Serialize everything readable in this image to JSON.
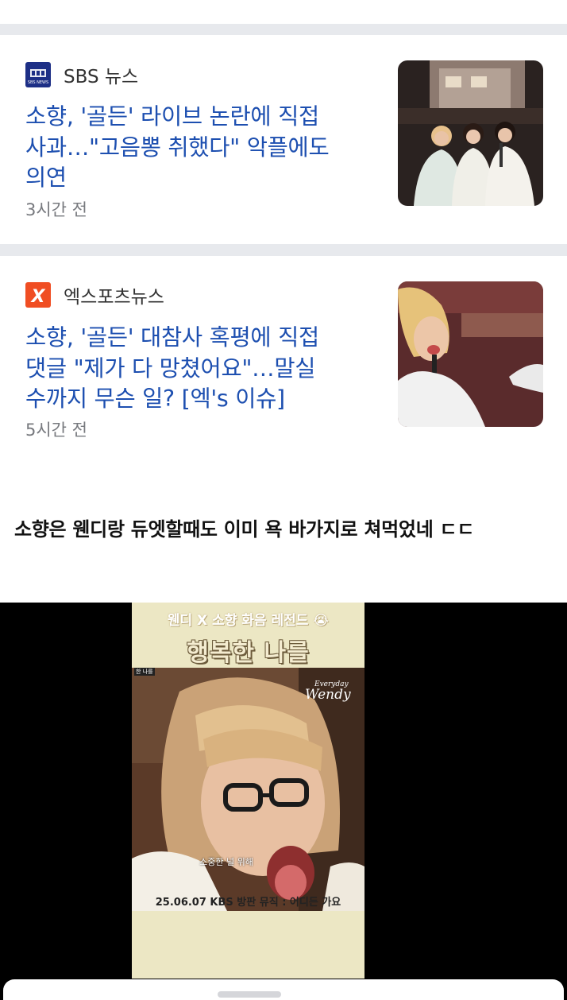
{
  "articles": [
    {
      "source": "SBS 뉴스",
      "logo": "SBS NEWS",
      "headline_lines": [
        "소향, '골든' 라이브 논란에 직접",
        "사과…\"고음뽕 취했다\" 악플에도",
        "의연"
      ],
      "time": "3시간 전",
      "accent": "#1d2f86"
    },
    {
      "source": "엑스포츠뉴스",
      "logo": "X",
      "headline_lines": [
        "소향, '골든' 대참사 혹평에 직접",
        "댓글 \"제가 다 망쳤어요\"…말실",
        "수까지 무슨 일? [엑's 이슈]"
      ],
      "time": "5시간 전",
      "accent": "#f04e23"
    }
  ],
  "comment": "소향은 웬디랑 듀엣할때도 이미 욕 바가지로 쳐먹었네 ㄷㄷ",
  "video": {
    "top_text": "웬디 X 소향 화음 레전드 😭",
    "title": "행복한 나를",
    "small_tag": "한 나를",
    "brand_line1": "Everyday",
    "brand_line2": "Wendy",
    "subtitle": "소중한 널 위해",
    "caption": "25.06.07 KBS 방판 뮤직 : 어디든 가요"
  },
  "colors": {
    "headline": "#1d4fb0",
    "separator": "#e7e9ed",
    "video_background": "#ece7c4"
  }
}
